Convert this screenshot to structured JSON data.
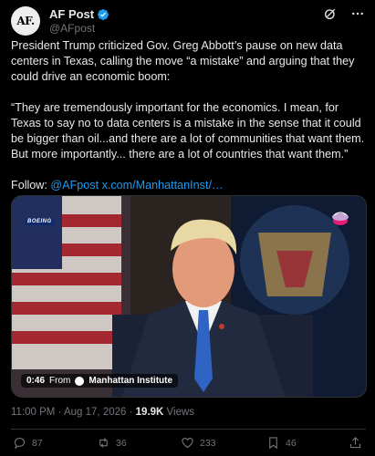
{
  "header": {
    "avatar_text": "AF.",
    "display_name": "AF Post",
    "handle": "@AFpost",
    "icons": [
      "grok-icon",
      "more-options-icon"
    ]
  },
  "tweet": {
    "paragraph1": "President Trump criticized Gov. Greg Abbott’s pause on new data centers in Texas, calling the move “a mistake” and arguing that they could drive an economic boom:",
    "paragraph2": "“They are tremendously important for the economics. I mean, for Texas to say no to data centers is a mistake in the sense that it could be bigger than oil...and there are a lot of communities that want them. But more importantly... there are a lot of countries that want them.”",
    "follow_label": "Follow:",
    "follow_handle": "@AFpost",
    "follow_link": "x.com/ManhattanInst/…"
  },
  "media": {
    "duration": "0:46",
    "from_label": "From",
    "source_name": "Manhattan Institute",
    "watermark": "BOEING"
  },
  "meta": {
    "time": "11:00 PM",
    "separator": "·",
    "date": "Aug 17, 2026",
    "views_count": "19.9K",
    "views_label": "Views"
  },
  "actions": {
    "replies": "87",
    "reposts": "36",
    "likes": "233",
    "bookmarks": "46",
    "icons": [
      "reply-icon",
      "repost-icon",
      "like-icon",
      "bookmark-icon",
      "share-icon"
    ]
  },
  "colors": {
    "background": "#000000",
    "text": "#e7e9ea",
    "muted": "#71767b",
    "link": "#1d9bf0",
    "verified": "#1d9bf0"
  }
}
